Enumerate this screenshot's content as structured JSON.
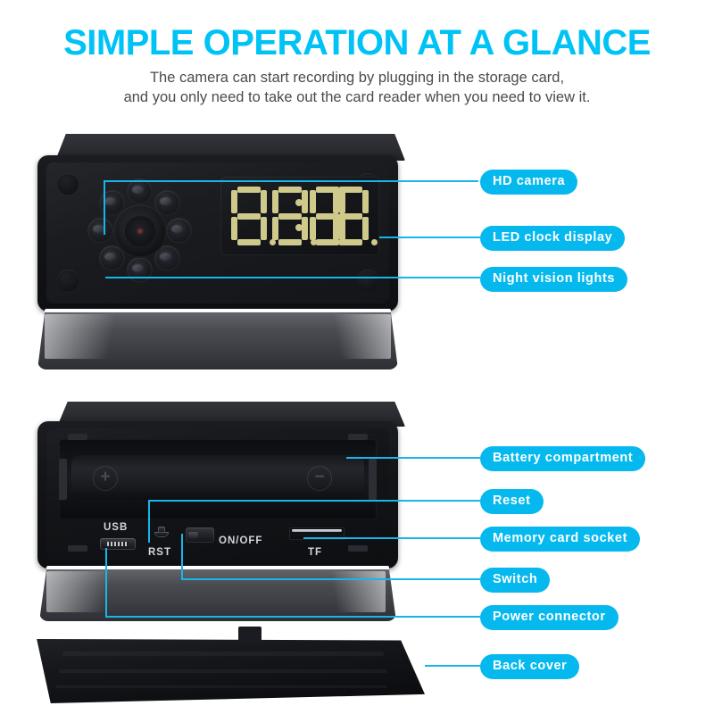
{
  "header": {
    "title": "SIMPLE OPERATION AT A GLANCE",
    "subtitle_line1": "The camera can start recording by plugging in the storage card,",
    "subtitle_line2": "and you only need to take out the card reader when you need to view it."
  },
  "colors": {
    "title": "#00c3f5",
    "pill_background": "#05b9ef",
    "pill_text": "#ffffff",
    "leader_line": "#17b6e8",
    "subtitle_text": "#4b4b4b",
    "led_segment": "#cfc98c",
    "device_body": "#131418",
    "background": "#ffffff"
  },
  "callouts": {
    "front": [
      {
        "id": "hd-camera",
        "label": "HD camera"
      },
      {
        "id": "led-clock-display",
        "label": "LED clock display"
      },
      {
        "id": "night-vision-lights",
        "label": "Night vision lights"
      }
    ],
    "back": [
      {
        "id": "battery-compartment",
        "label": "Battery compartment"
      },
      {
        "id": "reset",
        "label": "Reset"
      },
      {
        "id": "memory-card-socket",
        "label": "Memory card socket"
      },
      {
        "id": "switch",
        "label": "Switch"
      },
      {
        "id": "power-connector",
        "label": "Power connector"
      },
      {
        "id": "back-cover",
        "label": "Back cover"
      }
    ]
  },
  "front_device": {
    "name": "clock-camera-front-view",
    "display": {
      "value": "88:88",
      "digits": [
        "8",
        "8",
        "8",
        "8"
      ],
      "separator": ":",
      "decimal_points": 4
    },
    "ir_led_count": 8,
    "lens": "camera-lens",
    "screw_count": 4
  },
  "back_device": {
    "name": "clock-camera-back-view",
    "io_labels": {
      "usb": "USB",
      "reset": "RST",
      "switch": "ON/OFF",
      "card_slot": "TF"
    },
    "battery": {
      "positive_terminal": "+",
      "negative_terminal": "−"
    }
  }
}
